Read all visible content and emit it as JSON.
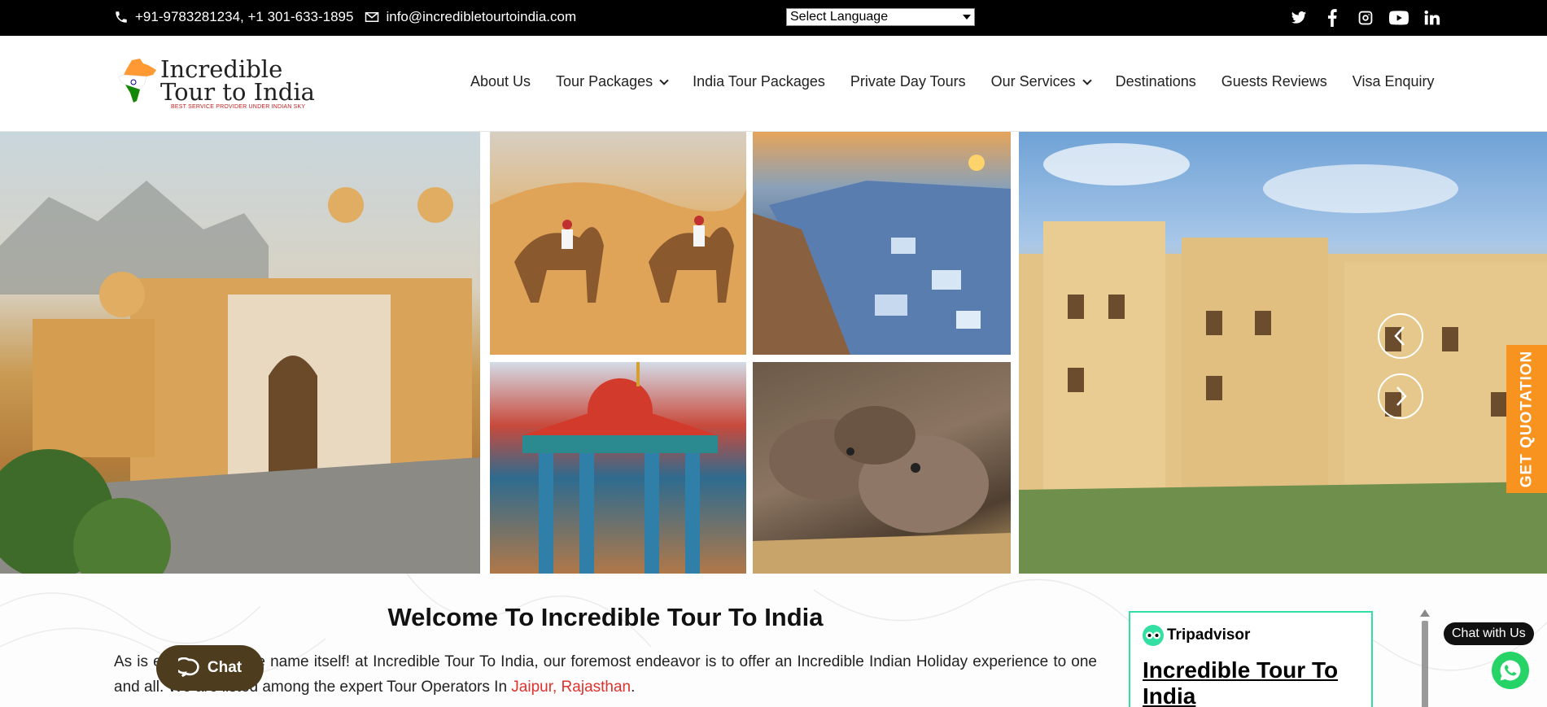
{
  "topbar": {
    "phones": "+91-9783281234, +1 301-633-1895",
    "email": "info@incredibletourtoindia.com",
    "language_select": "Select Language",
    "socials": [
      "twitter-icon",
      "facebook-icon",
      "instagram-icon",
      "youtube-icon",
      "linkedin-icon"
    ]
  },
  "logo": {
    "line1": "Incredible",
    "line2": "Tour to India",
    "tagline": "BEST SERVICE PROVIDER UNDER INDIAN SKY"
  },
  "nav": {
    "items": [
      {
        "label": "About Us",
        "dropdown": false
      },
      {
        "label": "Tour Packages",
        "dropdown": true
      },
      {
        "label": "India Tour Packages",
        "dropdown": false
      },
      {
        "label": "Private Day Tours",
        "dropdown": false
      },
      {
        "label": "Our Services",
        "dropdown": true
      },
      {
        "label": "Destinations",
        "dropdown": false
      },
      {
        "label": "Guests Reviews",
        "dropdown": false
      },
      {
        "label": "Visa Enquiry",
        "dropdown": false
      }
    ]
  },
  "hero": {
    "quote_tab": "GET QUOTATION"
  },
  "welcome": {
    "title": "Welcome To Incredible Tour To India",
    "text_before": "As is evident from the name itself! at Incredible Tour To India, our foremost endeavor is to offer an Incredible Indian Holiday experience to one and all. We are listed among the expert Tour Operators In ",
    "link_text": "Jaipur, Rajasthan",
    "text_after": "."
  },
  "chat": {
    "label": "Chat"
  },
  "tripadvisor": {
    "brand": "Tripadvisor",
    "name": "Incredible Tour To India"
  },
  "whatsapp": {
    "label": "Chat with Us"
  },
  "colors": {
    "topbar_bg": "#000000",
    "accent_orange": "#f7931e",
    "link_red": "#e0312c",
    "tripadvisor_green": "#34e0a1",
    "whatsapp_green": "#25d366",
    "chat_brown": "#4d3d1e"
  }
}
